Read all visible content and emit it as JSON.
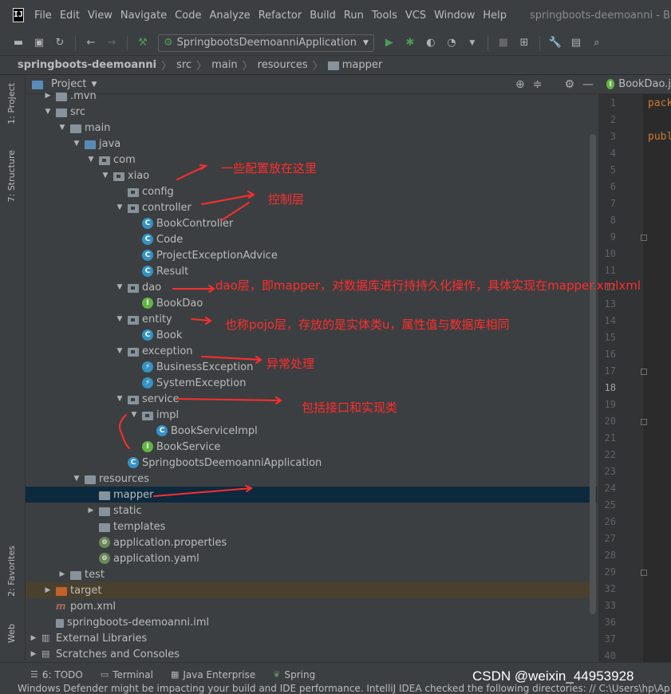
{
  "menubar": {
    "logo_text": "IJ",
    "items": [
      "File",
      "Edit",
      "View",
      "Navigate",
      "Code",
      "Analyze",
      "Refactor",
      "Build",
      "Run",
      "Tools",
      "VCS",
      "Window",
      "Help"
    ],
    "window_title": "springboots-deemoanni - Book.ja"
  },
  "toolbar": {
    "run_config": "SpringbootsDeemoanniApplication"
  },
  "breadcrumb": [
    "springboots-deemoanni",
    "src",
    "main",
    "resources",
    "mapper"
  ],
  "left_tabs": [
    "1: Project",
    "7: Structure",
    "2: Favorites",
    "Web"
  ],
  "project_panel": {
    "title": "Project"
  },
  "tree": [
    {
      "label": ".mvn"
    },
    {
      "label": "src"
    },
    {
      "label": "main"
    },
    {
      "label": "java"
    },
    {
      "label": "com"
    },
    {
      "label": "xiao"
    },
    {
      "label": "config"
    },
    {
      "label": "controller"
    },
    {
      "label": "BookController"
    },
    {
      "label": "Code"
    },
    {
      "label": "ProjectExceptionAdvice"
    },
    {
      "label": "Result"
    },
    {
      "label": "dao"
    },
    {
      "label": "BookDao"
    },
    {
      "label": "entity"
    },
    {
      "label": "Book"
    },
    {
      "label": "exception"
    },
    {
      "label": "BusinessException"
    },
    {
      "label": "SystemException"
    },
    {
      "label": "service"
    },
    {
      "label": "impl"
    },
    {
      "label": "BookServiceImpl"
    },
    {
      "label": "BookService"
    },
    {
      "label": "SpringbootsDeemoanniApplication"
    },
    {
      "label": "resources"
    },
    {
      "label": "mapper"
    },
    {
      "label": "static"
    },
    {
      "label": "templates"
    },
    {
      "label": "application.properties"
    },
    {
      "label": "application.yaml"
    },
    {
      "label": "test"
    },
    {
      "label": "target"
    },
    {
      "label": "pom.xml"
    },
    {
      "label": "springboots-deemoanni.iml"
    },
    {
      "label": "External Libraries"
    },
    {
      "label": "Scratches and Consoles"
    }
  ],
  "editor": {
    "tab": "BookDao.j",
    "line_numbers": [
      "1",
      "2",
      "3",
      "4",
      "5",
      "6",
      "7",
      "8",
      "9",
      "10",
      "11",
      "12",
      "13",
      "14",
      "15",
      "16",
      "17",
      "18",
      "19",
      "20",
      "21",
      "22",
      "23",
      "24",
      "25",
      "26",
      "27",
      "28",
      "29",
      "32",
      "33",
      "36",
      "37",
      "40"
    ],
    "current_line": "18",
    "code_line1": "pack",
    "code_line3": "publ"
  },
  "statusbar": {
    "tabs": [
      "6: TODO",
      "Terminal",
      "Java Enterprise",
      "Spring"
    ],
    "message": "Windows Defender might be impacting your build and IDE performance. IntelliJ IDEA checked the following directories: // C:\\Users\\hp\\Ap"
  },
  "annotations": {
    "config_note": "一些配置放在这里",
    "controller_note": "控制层",
    "dao_note": "dao层，即mapper，对数据库进行持持久化操作，具体实现在mapper.xmlxml",
    "entity_note": "也称pojo层，存放的是实体类u，属性值与数据库相同",
    "exception_note": "异常处理",
    "service_note": "包括接口和实现类"
  },
  "watermark": "CSDN @weixin_44953928",
  "colors": {
    "annotation": "#ff2d2d",
    "selection": "#0d293e",
    "panel": "#3c3f41"
  }
}
